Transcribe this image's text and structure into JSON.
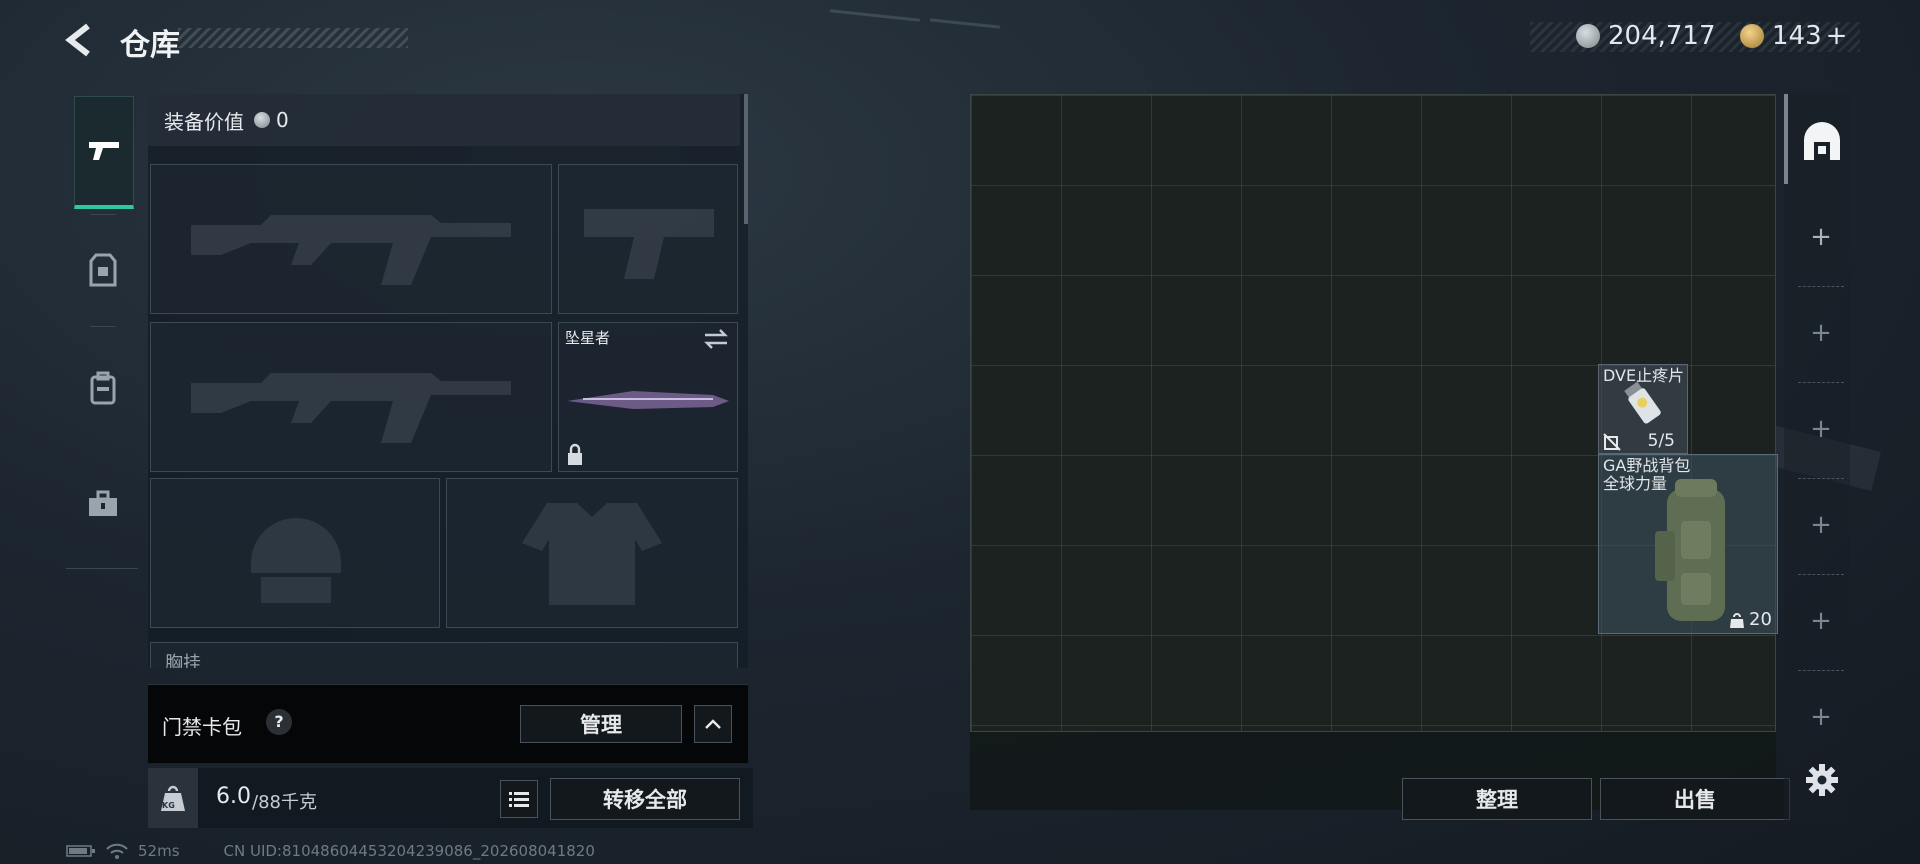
{
  "header": {
    "title": "仓库"
  },
  "currency": {
    "primary": "204,717",
    "secondary": "143",
    "add_symbol": "+"
  },
  "left_tabs": [
    "gun-icon",
    "armor-icon",
    "backpack-icon",
    "toolkit-icon"
  ],
  "loadout": {
    "value_label": "装备价值",
    "value": "0",
    "melee": {
      "name": "坠星者"
    },
    "chest_label_partial": "胸挂"
  },
  "access_card": {
    "label": "门禁卡包",
    "help": "?",
    "manage_label": "管理"
  },
  "weight": {
    "current": "6.0",
    "max": "/88千克",
    "kg_badge": "KG",
    "transfer_all_label": "转移全部"
  },
  "stash": {
    "items": [
      {
        "name": "DVE止疼片",
        "count": "5/5"
      },
      {
        "name": "GA野战背包",
        "subtitle": "全球力量",
        "capacity": "20"
      }
    ],
    "sort_label": "整理",
    "sell_label": "出售"
  },
  "status_bar": {
    "ping": "52ms",
    "uid": "CN UID:8104860445320423908­6_202608041820"
  },
  "colors": {
    "accent": "#2ec7a0",
    "background": "#1d2630"
  }
}
